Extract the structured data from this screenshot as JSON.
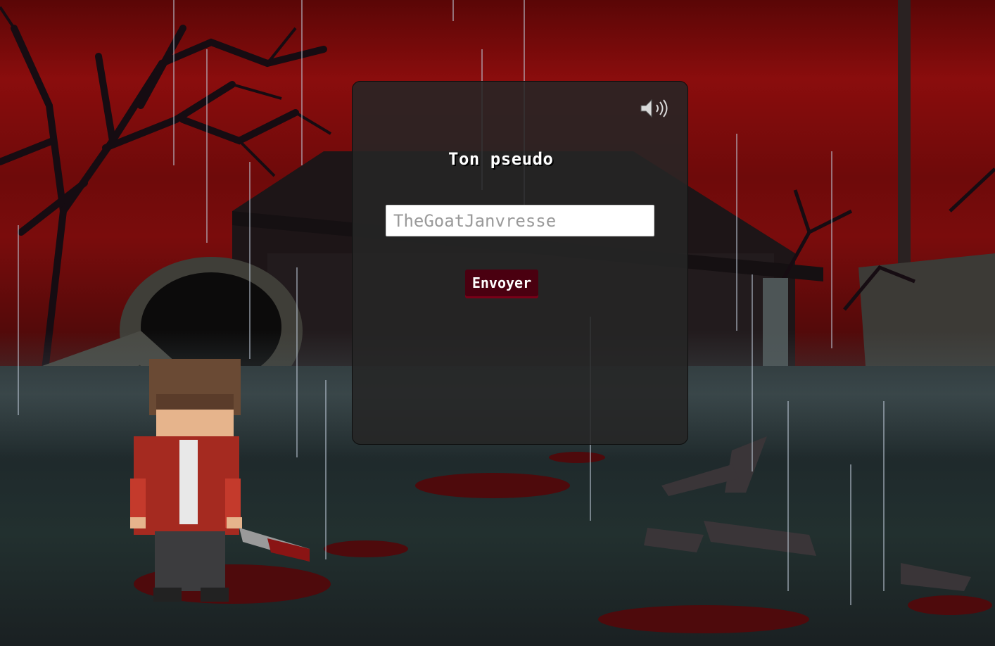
{
  "form": {
    "title": "Ton pseudo",
    "pseudo_placeholder": "TheGoatJanvresse",
    "submit_label": "Envoyer"
  },
  "controls": {
    "sound_icon": "speaker-volume-icon"
  },
  "colors": {
    "sky_red": "#7a0c0c",
    "panel_bg": "#262626",
    "button_bg": "#4a0010",
    "title_text": "#ffffff"
  }
}
